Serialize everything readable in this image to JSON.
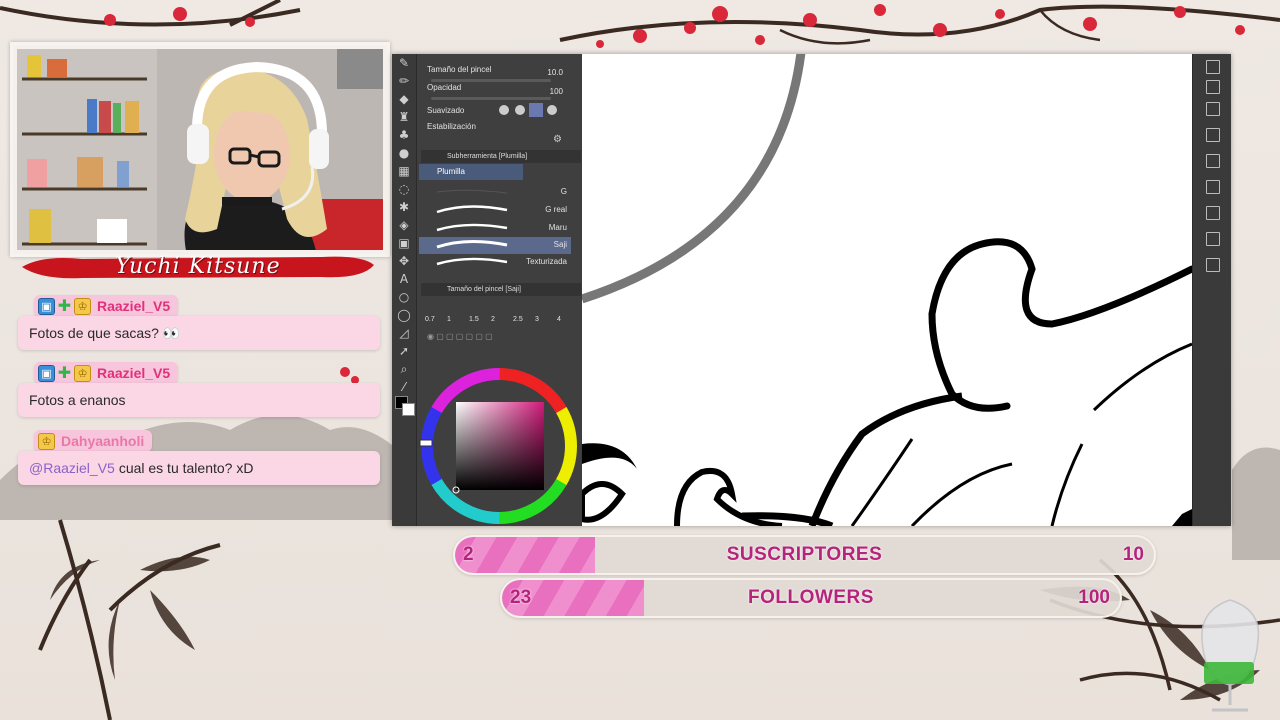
{
  "streamer": {
    "name": "Yuchi  Kitsune"
  },
  "chat": {
    "messages": [
      {
        "user": "Raaziel_V5",
        "badges": [
          "blue-square-icon",
          "green-plus-icon",
          "crown-icon"
        ],
        "text": "Fotos de que sacas? 👀",
        "mention": ""
      },
      {
        "user": "Raaziel_V5",
        "badges": [
          "blue-square-icon",
          "green-plus-icon",
          "crown-icon"
        ],
        "text": "Fotos a enanos",
        "mention": ""
      },
      {
        "user": "Dahyaanholi",
        "badges": [
          "crown-icon"
        ],
        "text": "cual es tu talento? xD",
        "mention": "@Raaziel_V5"
      }
    ]
  },
  "app": {
    "properties": [
      {
        "label": "Tamaño del pincel",
        "value": "10.0"
      },
      {
        "label": "Opacidad",
        "value": "100"
      },
      {
        "label": "Suavizado",
        "value": ""
      },
      {
        "label": "Estabilización",
        "value": ""
      }
    ],
    "subtool_header": "Subherramienta [Plumilla]",
    "subtool_tab": "Plumilla",
    "brushes": [
      {
        "label": "G",
        "selected": false
      },
      {
        "label": "G real",
        "selected": false
      },
      {
        "label": "Maru",
        "selected": false
      },
      {
        "label": "Saji",
        "selected": true
      },
      {
        "label": "Texturizada",
        "selected": false
      }
    ],
    "brush_size_header": "Tamaño del pincel [Saji]",
    "brush_sizes": [
      "0.7",
      "1",
      "1.5",
      "2",
      "2.5",
      "3",
      "4"
    ],
    "colors": {
      "fg": "#000000",
      "bg": "#ffffff",
      "accent": "#5b6a8c"
    }
  },
  "goals": [
    {
      "current": "2",
      "label": "SUSCRIPTORES",
      "target": "10",
      "progress": 0.2
    },
    {
      "current": "23",
      "label": "FOLLOWERS",
      "target": "100",
      "progress": 0.23
    }
  ],
  "colors": {
    "chat_bubble": "#fbd6e4",
    "username": "#e0317a",
    "bar_fill": "#e96fbf",
    "bar_text": "#b6237d"
  }
}
